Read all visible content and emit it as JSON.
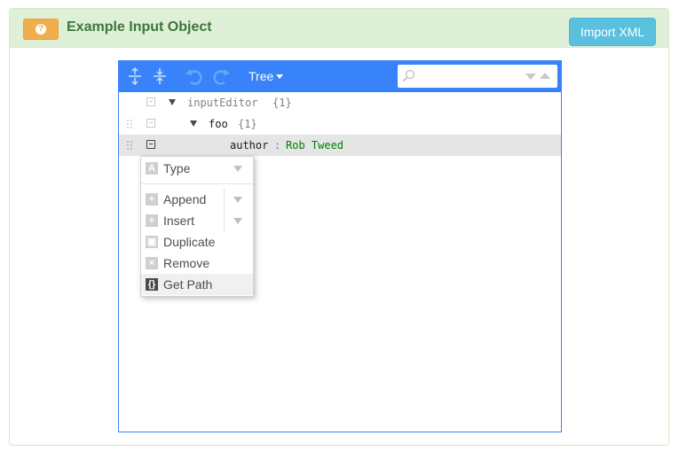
{
  "panel": {
    "help_icon": "question-icon",
    "title": "Example Input Object",
    "import_button": "Import XML"
  },
  "editor": {
    "toolbar": {
      "expand_icon": "expand-all-icon",
      "collapse_icon": "collapse-all-icon",
      "undo_icon": "undo-icon",
      "redo_icon": "redo-icon",
      "mode_label": "Tree",
      "search_placeholder": ""
    },
    "tree": {
      "root": {
        "field": "inputEditor",
        "count": "{1}"
      },
      "child": {
        "field": "foo",
        "count": "{1}"
      },
      "leaf": {
        "field": "author",
        "separator": ":",
        "value": "Rob Tweed"
      }
    },
    "context_menu": {
      "items": [
        {
          "label": "Type",
          "icon": "type-icon"
        },
        {
          "label": "Append",
          "icon": "append-icon"
        },
        {
          "label": "Insert",
          "icon": "insert-icon"
        },
        {
          "label": "Duplicate",
          "icon": "duplicate-icon"
        },
        {
          "label": "Remove",
          "icon": "remove-icon"
        },
        {
          "label": "Get Path",
          "icon": "get-path-icon"
        }
      ]
    }
  },
  "colors": {
    "menu_bar": "#3883fa",
    "value_text": "#008000",
    "panel_heading": "#dff0d8",
    "title_text": "#3c763d"
  }
}
